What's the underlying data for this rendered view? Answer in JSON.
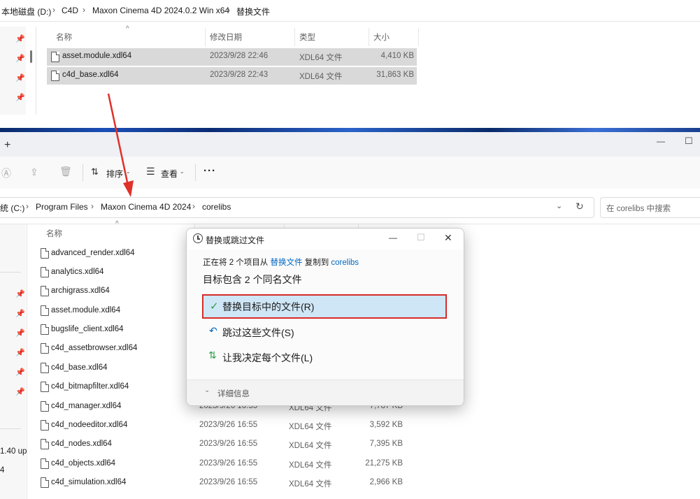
{
  "top_window": {
    "breadcrumb": [
      "本地磁盘 (D:)",
      "C4D",
      "Maxon Cinema 4D 2024.0.2 Win x64",
      "替换文件"
    ],
    "columns": [
      "名称",
      "修改日期",
      "类型",
      "大小"
    ],
    "files": [
      {
        "name": "asset.module.xdl64",
        "date": "2023/9/28 22:46",
        "type": "XDL64 文件",
        "size": "4,410 KB"
      },
      {
        "name": "c4d_base.xdl64",
        "date": "2023/9/28 22:43",
        "type": "XDL64 文件",
        "size": "31,863 KB"
      }
    ]
  },
  "bottom_window": {
    "tab_add": "+",
    "window_controls": {
      "minimize": "—",
      "maximize": "☐"
    },
    "toolbar": {
      "sort": "排序",
      "view": "查看",
      "more": "···"
    },
    "breadcrumb": [
      "统 (C:)",
      "Program Files",
      "Maxon Cinema 4D 2024",
      "corelibs"
    ],
    "search_placeholder": "在 corelibs 中搜索",
    "column_name": "名称",
    "nav_fragments": [
      "1.40 up",
      "4"
    ],
    "files": [
      {
        "name": "advanced_render.xdl64"
      },
      {
        "name": "analytics.xdl64"
      },
      {
        "name": "archigrass.xdl64"
      },
      {
        "name": "asset.module.xdl64"
      },
      {
        "name": "bugslife_client.xdl64"
      },
      {
        "name": "c4d_assetbrowser.xdl64"
      },
      {
        "name": "c4d_base.xdl64"
      },
      {
        "name": "c4d_bitmapfilter.xdl64"
      },
      {
        "name": "c4d_manager.xdl64",
        "date": "2023/9/26 16:55",
        "type": "XDL64 文件",
        "size": "7,787 KB"
      },
      {
        "name": "c4d_nodeeditor.xdl64",
        "date": "2023/9/26 16:55",
        "type": "XDL64 文件",
        "size": "3,592 KB"
      },
      {
        "name": "c4d_nodes.xdl64",
        "date": "2023/9/26 16:55",
        "type": "XDL64 文件",
        "size": "7,395 KB"
      },
      {
        "name": "c4d_objects.xdl64",
        "date": "2023/9/26 16:55",
        "type": "XDL64 文件",
        "size": "21,275 KB"
      },
      {
        "name": "c4d_simulation.xdl64",
        "date": "2023/9/26 16:55",
        "type": "XDL64 文件",
        "size": "2,966 KB"
      }
    ]
  },
  "dialog": {
    "title": "替换或跳过文件",
    "info_prefix": "正在将 2 个项目从",
    "info_source": "替换文件",
    "info_mid": "复制到",
    "info_dest": "corelibs",
    "heading": "目标包含 2 个同名文件",
    "options": {
      "replace": "替换目标中的文件(R)",
      "skip": "跳过这些文件(S)",
      "decide": "让我决定每个文件(L)"
    },
    "details": "详细信息",
    "controls": {
      "minimize": "—",
      "maximize": "☐",
      "close": "✕"
    }
  },
  "colors": {
    "link": "#0067c0",
    "selected_row": "#d9d9d9",
    "highlight_option": "#cfe6f6",
    "highlight_border": "#d62b2b",
    "arrow": "#e0302a",
    "check": "#2f9e44"
  }
}
